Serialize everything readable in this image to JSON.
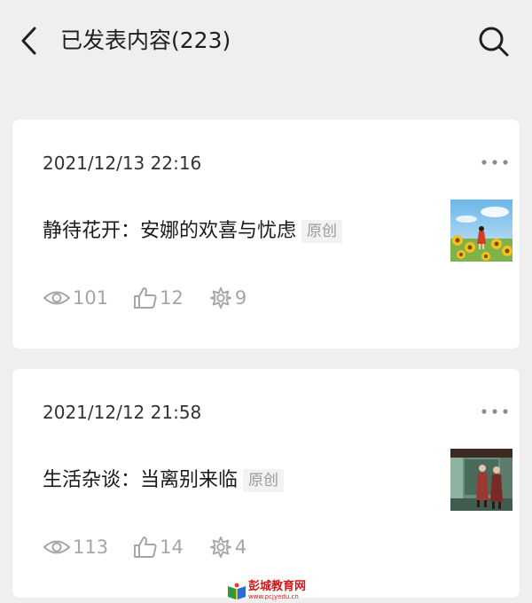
{
  "header": {
    "title": "已发表内容(223)",
    "back_icon": "chevron-left-icon",
    "search_icon": "search-icon"
  },
  "posts": [
    {
      "date": "2021/12/13 22:16",
      "title": "静待花开：安娜的欢喜与忧虑",
      "badge": "原创",
      "views": "101",
      "likes": "12",
      "shares": "9",
      "thumbnail": "girl-in-sunflower-field-image"
    },
    {
      "date": "2021/12/12 21:58",
      "title": "生活杂谈：当离别来临",
      "badge": "原创",
      "views": "113",
      "likes": "14",
      "shares": "4",
      "thumbnail": "women-in-hallway-image"
    }
  ],
  "watermark": {
    "text": "彭城教育网",
    "url": "www.pcjyedu.cn"
  },
  "colors": {
    "background": "#efefef",
    "card": "#ffffff",
    "stat_gray": "#a6a6a6",
    "badge_bg": "#f2f2f2"
  }
}
